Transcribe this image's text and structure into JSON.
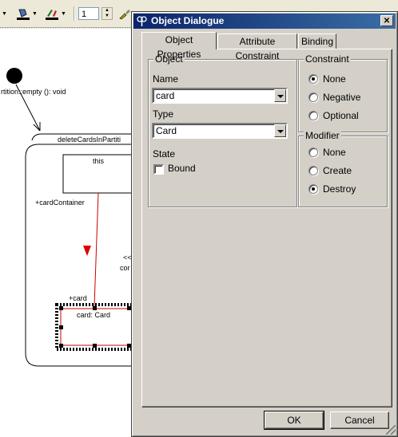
{
  "toolbar": {
    "line_width_value": "1",
    "icons": [
      "fill-color-icon",
      "line-color-icon",
      "line-width-icon",
      "format-brush-icon"
    ]
  },
  "diagram": {
    "transition_label": "rtition::empty (): void",
    "activity_title": "deleteCardsInPartiti",
    "this_object_label": "this",
    "link_role_label": "+cardContainer",
    "stereotype_label_line1": "<<",
    "stereotype_label_line2": "cor",
    "card_role_label": "+card",
    "card_object_label": "card: Card",
    "colors": {
      "link_color": "#cc0000",
      "arrow_color": "#dd0000"
    }
  },
  "dialog": {
    "title": "Object Dialogue",
    "close_label": "✕",
    "tabs": [
      {
        "label": "Object Properties",
        "active": true
      },
      {
        "label": "Attribute Constraint",
        "active": false
      },
      {
        "label": "Binding",
        "active": false
      }
    ],
    "object_group": {
      "label": "Object",
      "name_label": "Name",
      "name_value": "card",
      "type_label": "Type",
      "type_value": "Card",
      "state_label": "State",
      "bound_label": "Bound",
      "bound_checked": false
    },
    "constraint_group": {
      "label": "Constraint",
      "options": [
        "None",
        "Negative",
        "Optional"
      ],
      "selected": "None"
    },
    "modifier_group": {
      "label": "Modifier",
      "options": [
        "None",
        "Create",
        "Destroy"
      ],
      "selected": "Destroy"
    },
    "ok_label": "OK",
    "cancel_label": "Cancel",
    "colors": {
      "titlebar_start": "#0a246a",
      "titlebar_end": "#3a6ea5",
      "face": "#d4d0c8"
    }
  }
}
